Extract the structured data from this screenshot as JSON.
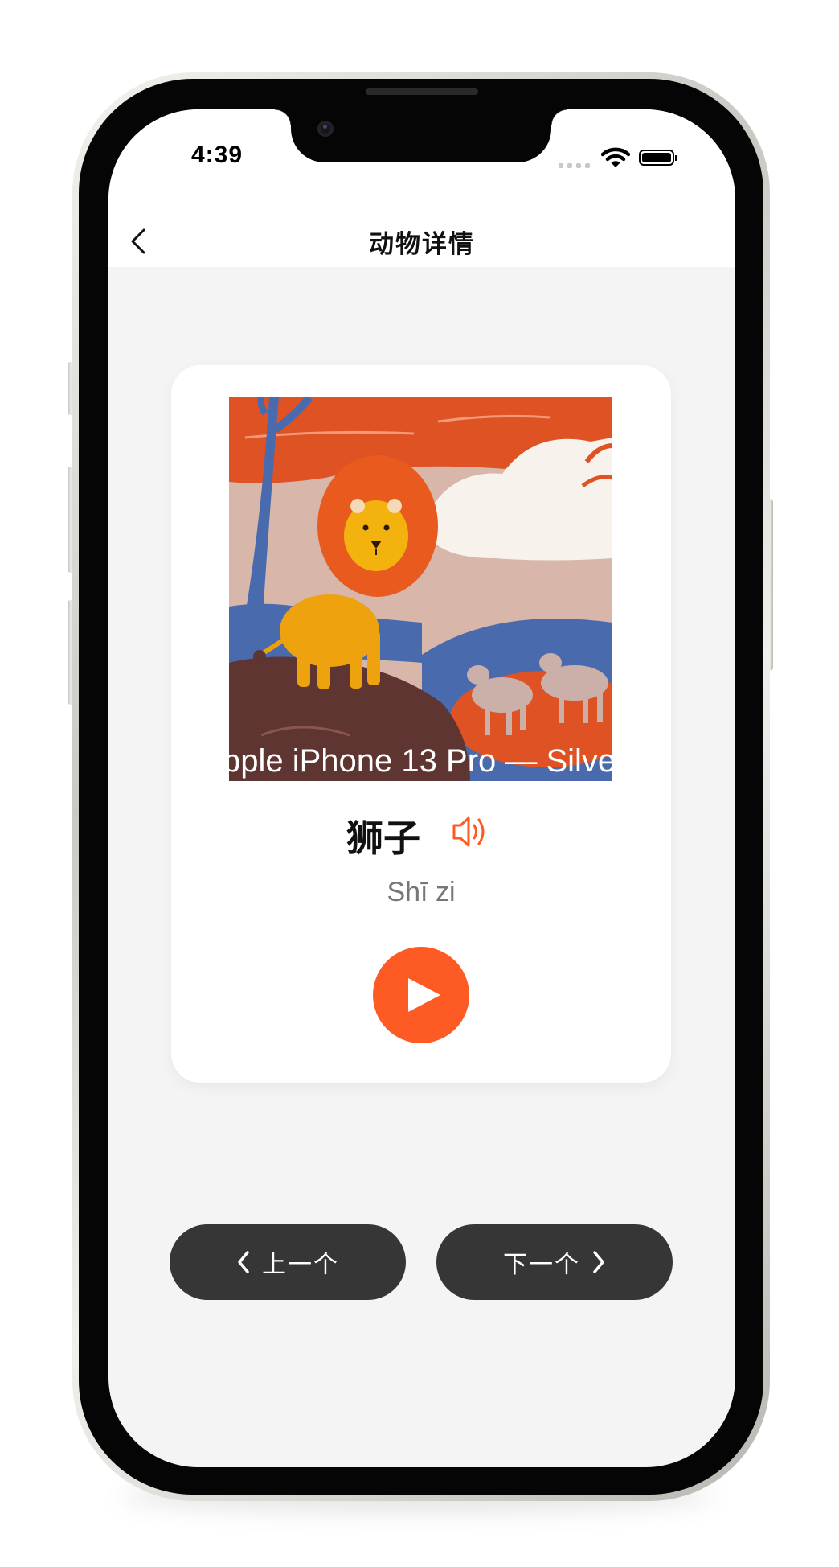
{
  "status_bar": {
    "time": "4:39"
  },
  "nav": {
    "title": "动物详情"
  },
  "card": {
    "image_caption": "pple iPhone 13 Pro — Silve",
    "animal_name": "狮子",
    "pinyin": "Shī zi"
  },
  "navigation": {
    "prev_label": "上一个",
    "next_label": "下一个"
  },
  "colors": {
    "accent": "#fd5a24",
    "pill_bg": "#363636",
    "screen_bg": "#f4f4f4",
    "card_bg": "#ffffff"
  },
  "icons": {
    "back": "chevron-left-icon",
    "sound": "speaker-icon",
    "play": "play-icon",
    "prev": "chevron-left-icon",
    "next": "chevron-right-icon"
  }
}
